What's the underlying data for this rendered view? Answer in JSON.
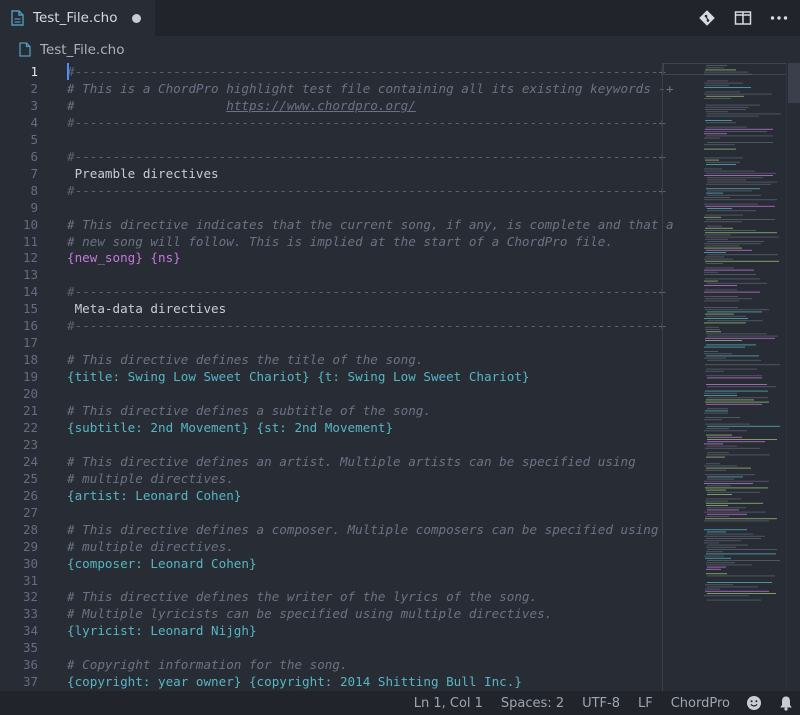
{
  "tab": {
    "title": "Test_File.cho",
    "dirty": true
  },
  "breadcrumb": {
    "label": "Test_File.cho"
  },
  "actions": [
    {
      "name": "git-compare-icon"
    },
    {
      "name": "split-editor-icon"
    },
    {
      "name": "more-actions-icon"
    }
  ],
  "editor": {
    "active_line": 1,
    "lines": [
      {
        "n": "1",
        "parts": [
          {
            "t": "#-----------------------------------------------------------------------------+",
            "c": "c-dash"
          }
        ]
      },
      {
        "n": "2",
        "parts": [
          {
            "t": "# This is a ChordPro highlight test file containing all its existing keywords -+",
            "c": "c-comment"
          }
        ]
      },
      {
        "n": "3",
        "parts": [
          {
            "t": "#                    ",
            "c": "c-comment"
          },
          {
            "t": "https://www.chordpro.org/",
            "c": "c-url"
          }
        ]
      },
      {
        "n": "4",
        "parts": [
          {
            "t": "#-----------------------------------------------------------------------------+",
            "c": "c-dash"
          }
        ]
      },
      {
        "n": "5",
        "parts": []
      },
      {
        "n": "6",
        "parts": [
          {
            "t": "#-----------------------------------------------------------------------------+",
            "c": "c-dash"
          }
        ]
      },
      {
        "n": "7",
        "parts": [
          {
            "t": " Preamble directives",
            "c": "c-heading"
          }
        ]
      },
      {
        "n": "8",
        "parts": [
          {
            "t": "#-----------------------------------------------------------------------------+",
            "c": "c-dash"
          }
        ]
      },
      {
        "n": "9",
        "parts": []
      },
      {
        "n": "10",
        "parts": [
          {
            "t": "# This directive indicates that the current song, if any, is complete and that a",
            "c": "c-comment"
          }
        ]
      },
      {
        "n": "11",
        "parts": [
          {
            "t": "# new song will follow. This is implied at the start of a ChordPro file.",
            "c": "c-comment"
          }
        ]
      },
      {
        "n": "12",
        "parts": [
          {
            "t": "{new_song} {ns}",
            "c": "c-magenta"
          }
        ]
      },
      {
        "n": "13",
        "parts": []
      },
      {
        "n": "14",
        "parts": [
          {
            "t": "#-----------------------------------------------------------------------------+",
            "c": "c-dash"
          }
        ]
      },
      {
        "n": "15",
        "parts": [
          {
            "t": " Meta-data directives",
            "c": "c-heading"
          }
        ]
      },
      {
        "n": "16",
        "parts": [
          {
            "t": "#-----------------------------------------------------------------------------+",
            "c": "c-dash"
          }
        ]
      },
      {
        "n": "17",
        "parts": []
      },
      {
        "n": "18",
        "parts": [
          {
            "t": "# This directive defines the title of the song.",
            "c": "c-comment"
          }
        ]
      },
      {
        "n": "19",
        "parts": [
          {
            "t": "{title: Swing Low Sweet Chariot} {t: Swing Low Sweet Chariot}",
            "c": "c-directive"
          }
        ]
      },
      {
        "n": "20",
        "parts": []
      },
      {
        "n": "21",
        "parts": [
          {
            "t": "# This directive defines a subtitle of the song.",
            "c": "c-comment"
          }
        ]
      },
      {
        "n": "22",
        "parts": [
          {
            "t": "{subtitle: 2nd Movement} {st: 2nd Movement}",
            "c": "c-directive"
          }
        ]
      },
      {
        "n": "23",
        "parts": []
      },
      {
        "n": "24",
        "parts": [
          {
            "t": "# This directive defines an artist. Multiple artists can be specified using",
            "c": "c-comment"
          }
        ]
      },
      {
        "n": "25",
        "parts": [
          {
            "t": "# multiple directives.",
            "c": "c-comment"
          }
        ]
      },
      {
        "n": "26",
        "parts": [
          {
            "t": "{artist: Leonard Cohen}",
            "c": "c-directive"
          }
        ]
      },
      {
        "n": "27",
        "parts": []
      },
      {
        "n": "28",
        "parts": [
          {
            "t": "# This directive defines a composer. Multiple composers can be specified using",
            "c": "c-comment"
          }
        ]
      },
      {
        "n": "29",
        "parts": [
          {
            "t": "# multiple directives.",
            "c": "c-comment"
          }
        ]
      },
      {
        "n": "30",
        "parts": [
          {
            "t": "{composer: Leonard Cohen}",
            "c": "c-directive"
          }
        ]
      },
      {
        "n": "31",
        "parts": []
      },
      {
        "n": "32",
        "parts": [
          {
            "t": "# This directive defines the writer of the lyrics of the song.",
            "c": "c-comment"
          }
        ]
      },
      {
        "n": "33",
        "parts": [
          {
            "t": "# Multiple lyricists can be specified using multiple directives.",
            "c": "c-comment"
          }
        ]
      },
      {
        "n": "34",
        "parts": [
          {
            "t": "{lyricist: Leonard Nijgh}",
            "c": "c-directive"
          }
        ]
      },
      {
        "n": "35",
        "parts": []
      },
      {
        "n": "36",
        "parts": [
          {
            "t": "# Copyright information for the song.",
            "c": "c-comment"
          }
        ]
      },
      {
        "n": "37",
        "parts": [
          {
            "t": "{copyright: year owner} {copyright: 2014 Shitting Bull Inc.}",
            "c": "c-directive"
          }
        ]
      }
    ]
  },
  "status": {
    "position": "Ln 1, Col 1",
    "indent": "Spaces: 2",
    "encoding": "UTF-8",
    "eol": "LF",
    "language": "ChordPro"
  },
  "colors": {
    "background": "#282c34",
    "comment": "#6b7284",
    "directive": "#56b6c2",
    "keyword": "#c678dd",
    "line_number": "#636d83"
  }
}
